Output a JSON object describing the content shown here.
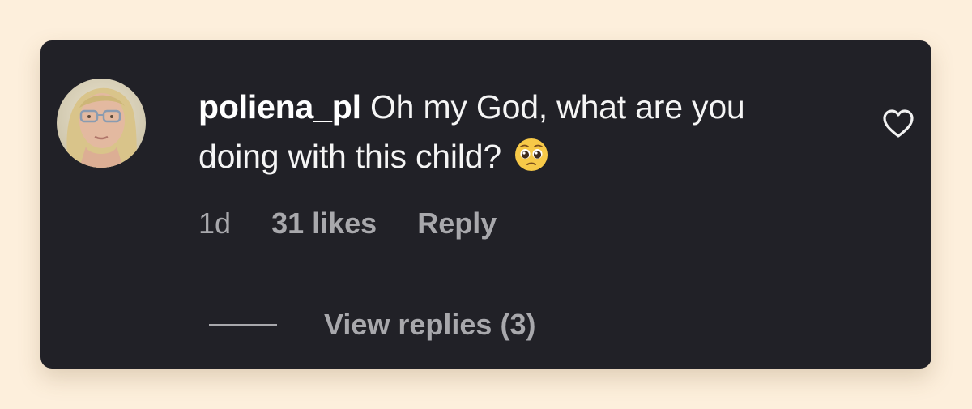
{
  "comment": {
    "username": "poliena_pl",
    "text": "Oh my God, what are you doing with this child?",
    "emoji_icon": "pleading-face-emoji",
    "time": "1d",
    "likes": "31 likes",
    "reply_label": "Reply",
    "view_replies_label": "View replies (3)",
    "like_icon": "heart-outline-icon"
  },
  "colors": {
    "page_background": "#fdefdc",
    "card_background": "#212127",
    "primary_text": "#f5f5f5",
    "secondary_text": "#a8a8ac"
  }
}
